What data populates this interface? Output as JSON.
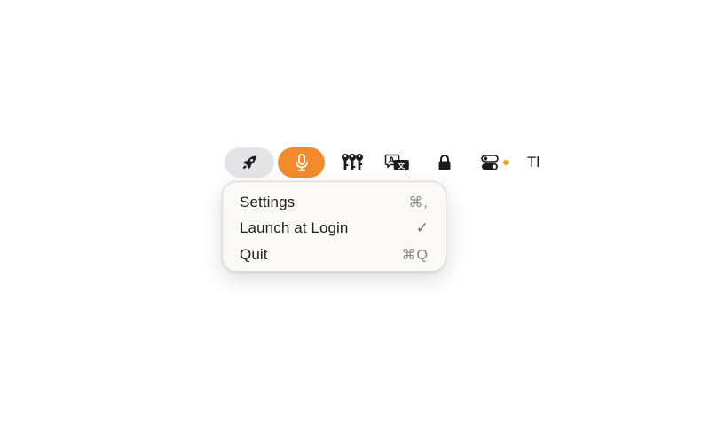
{
  "menubar": {
    "items": [
      {
        "icon": "rocket-icon",
        "state": "active-gray"
      },
      {
        "icon": "microphone-icon",
        "state": "active-orange"
      },
      {
        "icon": "keys-icon"
      },
      {
        "icon": "translate-icon"
      },
      {
        "icon": "lock-icon"
      },
      {
        "icon": "toggles-icon",
        "status_dot_color": "#f2a014"
      }
    ],
    "truncated_text": "Tl",
    "accent_orange": "#f28a2e",
    "pill_gray": "#e4e4e6"
  },
  "menu": {
    "items": [
      {
        "label": "Settings",
        "shortcut": "⌘,"
      },
      {
        "label": "Launch at Login",
        "checkmark": "✓"
      },
      {
        "label": "Quit",
        "shortcut": "⌘Q"
      }
    ]
  }
}
